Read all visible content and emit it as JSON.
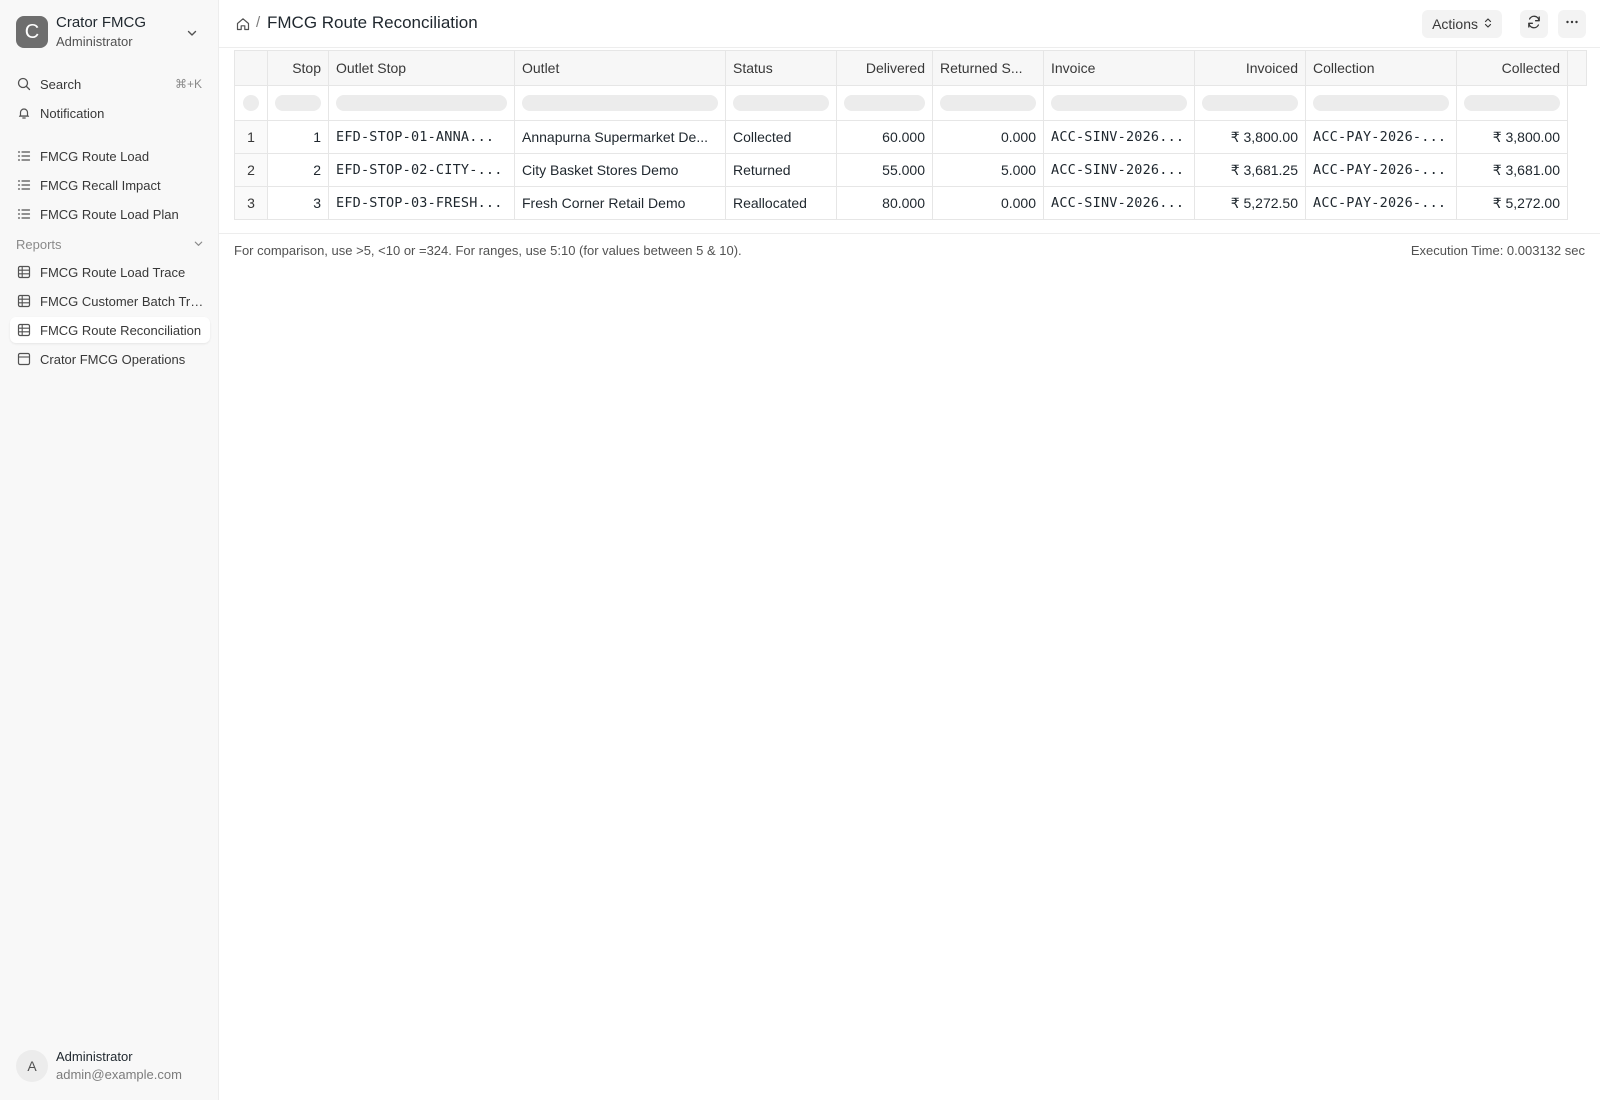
{
  "workspace": {
    "name": "Crator FMCG",
    "role": "Administrator",
    "logo_letter": "C"
  },
  "sidebar": {
    "search_label": "Search",
    "search_shortcut": "⌘+K",
    "notification_label": "Notification",
    "items": [
      {
        "label": "FMCG Route Load",
        "icon": "list-icon"
      },
      {
        "label": "FMCG Recall Impact",
        "icon": "list-icon"
      },
      {
        "label": "FMCG Route Load Plan",
        "icon": "list-icon"
      }
    ],
    "reports_section": "Reports",
    "reports": [
      {
        "label": "FMCG Route Load Trace",
        "icon": "table-icon"
      },
      {
        "label": "FMCG Customer Batch Trace",
        "icon": "table-icon"
      },
      {
        "label": "FMCG Route Reconciliation",
        "icon": "table-icon",
        "active": true
      },
      {
        "label": "Crator FMCG Operations",
        "icon": "dashboard-icon"
      }
    ]
  },
  "user": {
    "name": "Administrator",
    "email": "admin@example.com",
    "avatar_letter": "A"
  },
  "header": {
    "title": "FMCG Route Reconciliation",
    "breadcrumb_separator": "/",
    "actions_label": "Actions"
  },
  "table": {
    "columns": [
      "Stop",
      "Outlet Stop",
      "Outlet",
      "Status",
      "Delivered",
      "Returned S...",
      "Invoice",
      "Invoiced",
      "Collection",
      "Collected"
    ],
    "rows": [
      {
        "row": "1",
        "stop": "1",
        "outlet_stop": "EFD-STOP-01-ANNA...",
        "outlet": "Annapurna Supermarket De...",
        "status": "Collected",
        "delivered": "60.000",
        "returned": "0.000",
        "invoice": "ACC-SINV-2026...",
        "invoiced": "₹ 3,800.00",
        "collection": "ACC-PAY-2026-...",
        "collected": "₹ 3,800.00"
      },
      {
        "row": "2",
        "stop": "2",
        "outlet_stop": "EFD-STOP-02-CITY-...",
        "outlet": "City Basket Stores Demo",
        "status": "Returned",
        "delivered": "55.000",
        "returned": "5.000",
        "invoice": "ACC-SINV-2026...",
        "invoiced": "₹ 3,681.25",
        "collection": "ACC-PAY-2026-...",
        "collected": "₹ 3,681.00"
      },
      {
        "row": "3",
        "stop": "3",
        "outlet_stop": "EFD-STOP-03-FRESH...",
        "outlet": "Fresh Corner Retail Demo",
        "status": "Reallocated",
        "delivered": "80.000",
        "returned": "0.000",
        "invoice": "ACC-SINV-2026...",
        "invoiced": "₹ 5,272.50",
        "collection": "ACC-PAY-2026-...",
        "collected": "₹ 5,272.00"
      }
    ]
  },
  "footer": {
    "hint": "For comparison, use >5, <10 or =324. For ranges, use 5:10 (for values between 5 & 10).",
    "execution_time": "Execution Time: 0.003132 sec"
  }
}
